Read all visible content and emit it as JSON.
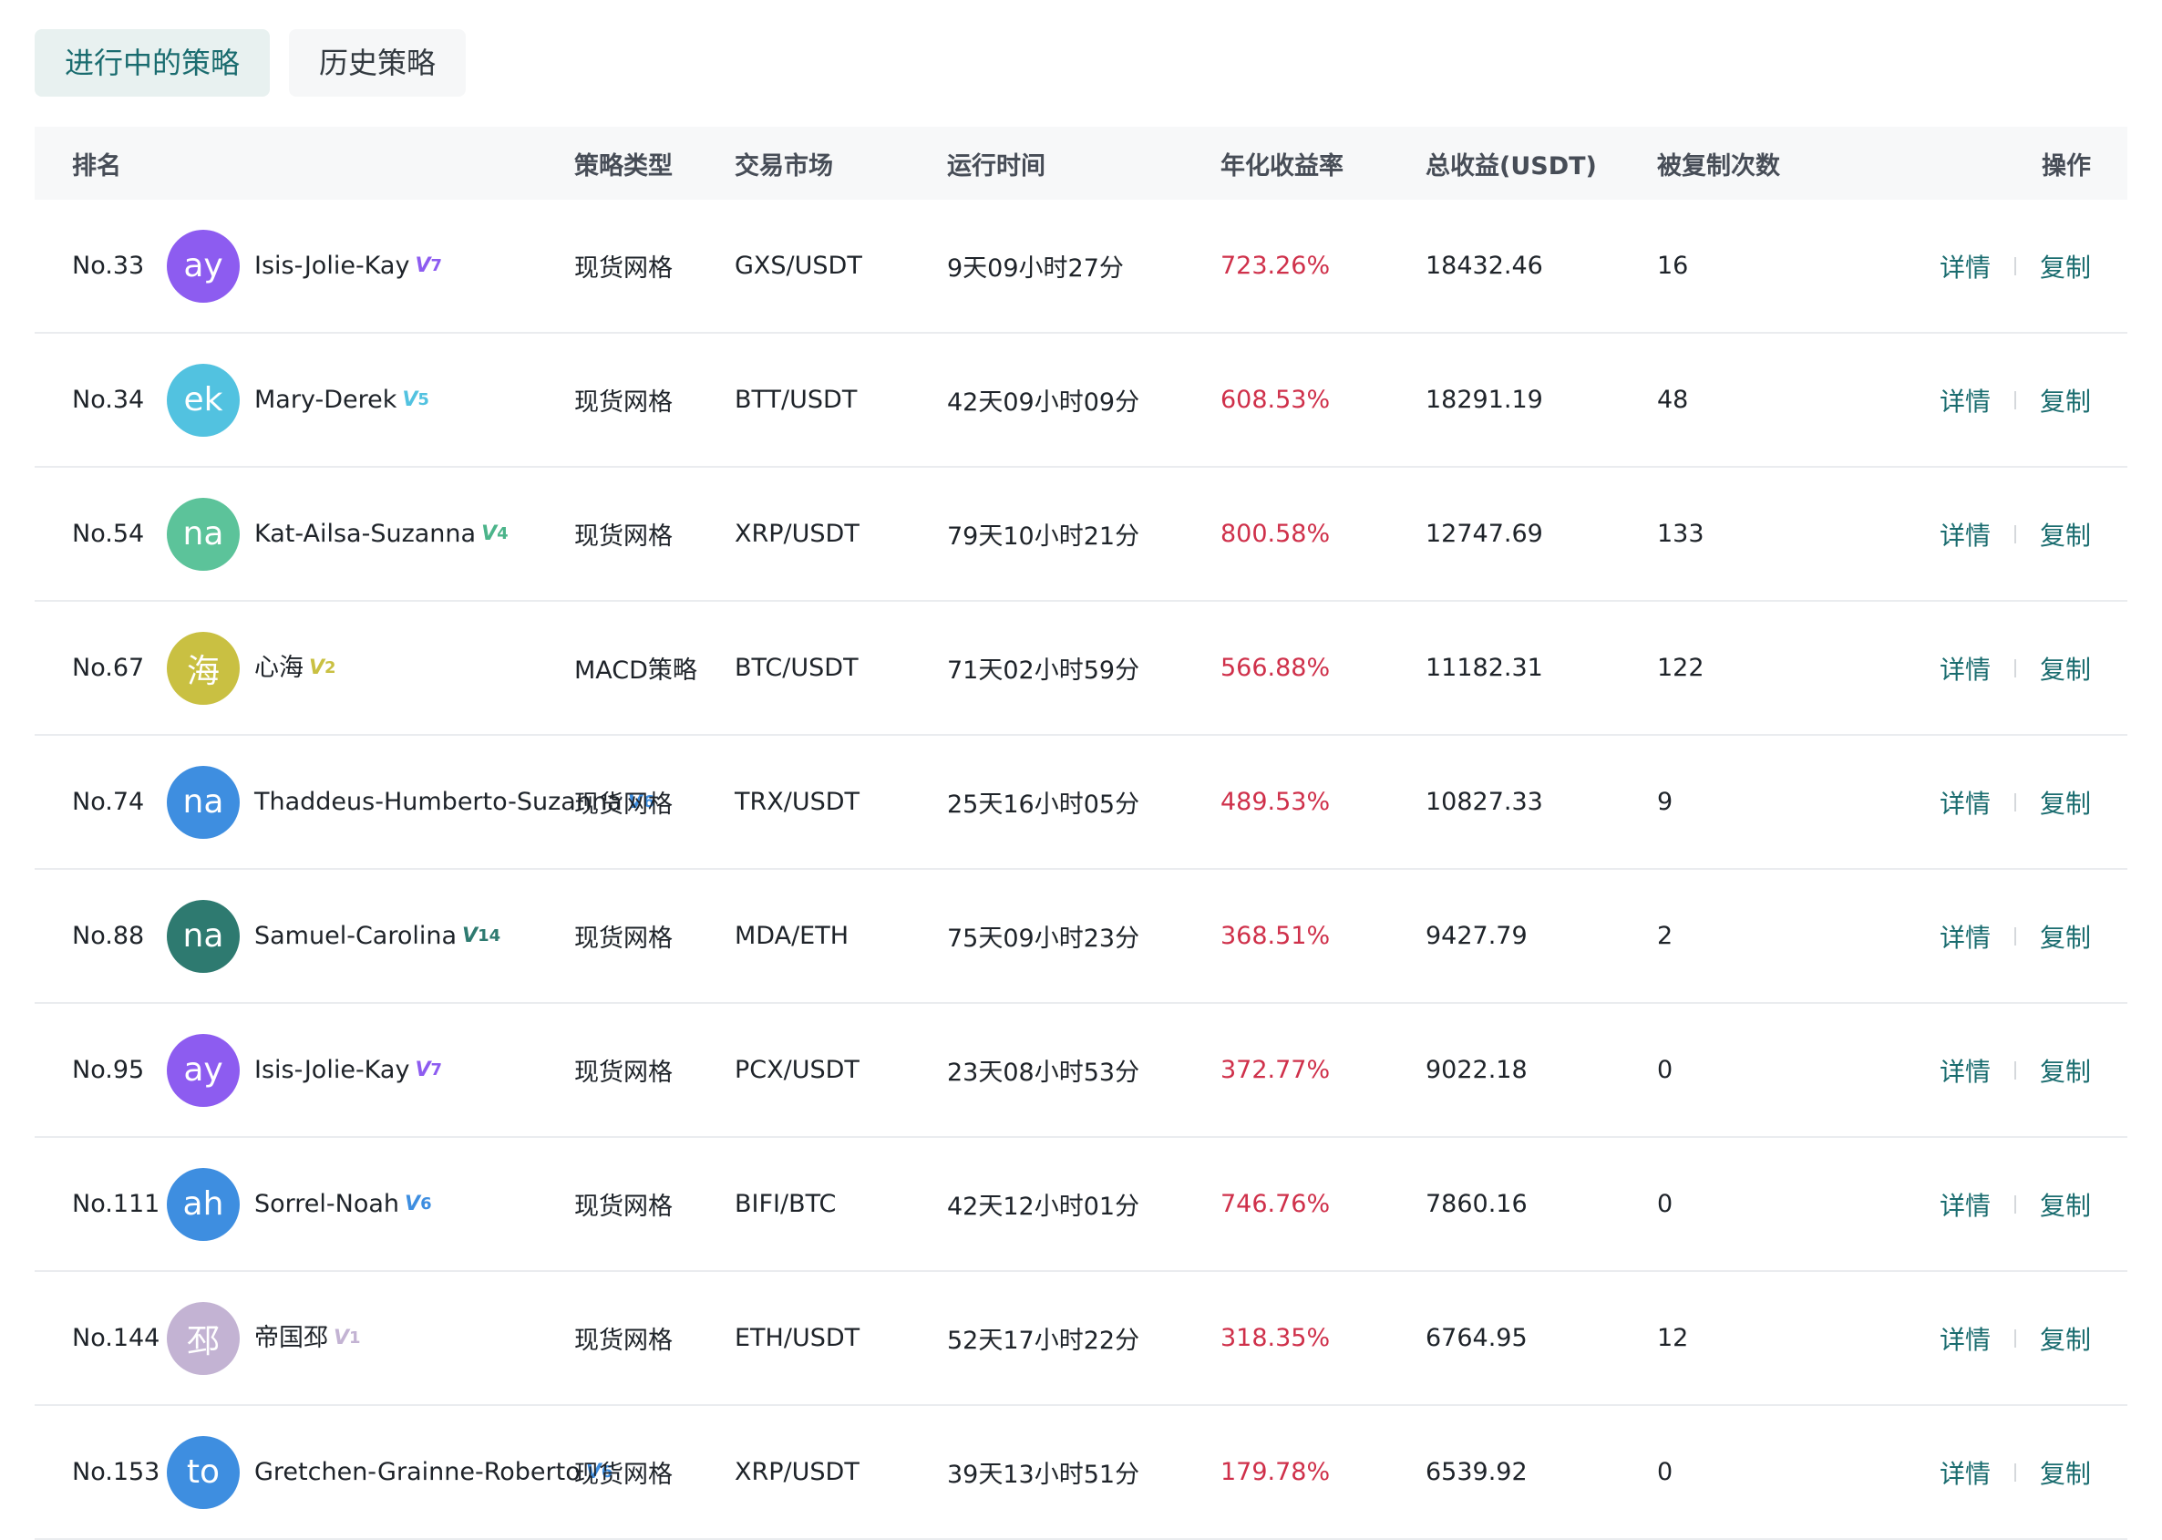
{
  "tabs": [
    {
      "label": "进行中的策略",
      "active": true
    },
    {
      "label": "历史策略",
      "active": false
    }
  ],
  "columns": {
    "rank": "排名",
    "type": "策略类型",
    "market": "交易市场",
    "time": "运行时间",
    "rate": "年化收益率",
    "total": "总收益(USDT)",
    "copies": "被复制次数",
    "op": "操作"
  },
  "actions": {
    "detail": "详情",
    "copy": "复制"
  },
  "colors": {
    "accent": "#1a6c6f",
    "profit": "#cf304a"
  },
  "rows": [
    {
      "rank": "No.33",
      "avatar": "ay",
      "avatar_color": "#8d5cf0",
      "name": "Isis-Jolie-Kay",
      "level": "7",
      "level_color": "#8d5cf0",
      "type": "现货网格",
      "market": "GXS/USDT",
      "time": "9天09小时27分",
      "rate": "723.26%",
      "total": "18432.46",
      "copies": "16"
    },
    {
      "rank": "No.34",
      "avatar": "ek",
      "avatar_color": "#52c2e0",
      "name": "Mary-Derek",
      "level": "5",
      "level_color": "#52c2e0",
      "type": "现货网格",
      "market": "BTT/USDT",
      "time": "42天09小时09分",
      "rate": "608.53%",
      "total": "18291.19",
      "copies": "48"
    },
    {
      "rank": "No.54",
      "avatar": "na",
      "avatar_color": "#5cc39a",
      "name": "Kat-Ailsa-Suzanna",
      "level": "4",
      "level_color": "#4bb48a",
      "type": "现货网格",
      "market": "XRP/USDT",
      "time": "79天10小时21分",
      "rate": "800.58%",
      "total": "12747.69",
      "copies": "133"
    },
    {
      "rank": "No.67",
      "avatar": "海",
      "avatar_color": "#c9c042",
      "name": "心海",
      "level": "2",
      "level_color": "#c9c042",
      "type": "MACD策略",
      "market": "BTC/USDT",
      "time": "71天02小时59分",
      "rate": "566.88%",
      "total": "11182.31",
      "copies": "122"
    },
    {
      "rank": "No.74",
      "avatar": "na",
      "avatar_color": "#3e8ee0",
      "name": "Thaddeus-Humberto-Suzanna",
      "level": "6",
      "level_color": "#3e8ee0",
      "type": "现货网格",
      "market": "TRX/USDT",
      "time": "25天16小时05分",
      "rate": "489.53%",
      "total": "10827.33",
      "copies": "9"
    },
    {
      "rank": "No.88",
      "avatar": "na",
      "avatar_color": "#2e7a70",
      "name": "Samuel-Carolina",
      "level": "14",
      "level_color": "#2e7a70",
      "type": "现货网格",
      "market": "MDA/ETH",
      "time": "75天09小时23分",
      "rate": "368.51%",
      "total": "9427.79",
      "copies": "2"
    },
    {
      "rank": "No.95",
      "avatar": "ay",
      "avatar_color": "#8d5cf0",
      "name": "Isis-Jolie-Kay",
      "level": "7",
      "level_color": "#8d5cf0",
      "type": "现货网格",
      "market": "PCX/USDT",
      "time": "23天08小时53分",
      "rate": "372.77%",
      "total": "9022.18",
      "copies": "0"
    },
    {
      "rank": "No.111",
      "avatar": "ah",
      "avatar_color": "#3e8ee0",
      "name": "Sorrel-Noah",
      "level": "6",
      "level_color": "#3e8ee0",
      "type": "现货网格",
      "market": "BIFI/BTC",
      "time": "42天12小时01分",
      "rate": "746.76%",
      "total": "7860.16",
      "copies": "0"
    },
    {
      "rank": "No.144",
      "avatar": "邳",
      "avatar_color": "#c3b3d3",
      "name": "帝国邳",
      "level": "1",
      "level_color": "#c3b3d3",
      "type": "现货网格",
      "market": "ETH/USDT",
      "time": "52天17小时22分",
      "rate": "318.35%",
      "total": "6764.95",
      "copies": "12"
    },
    {
      "rank": "No.153",
      "avatar": "to",
      "avatar_color": "#3e8ee0",
      "name": "Gretchen-Grainne-Roberto",
      "level": "6",
      "level_color": "#3e8ee0",
      "type": "现货网格",
      "market": "XRP/USDT",
      "time": "39天13小时51分",
      "rate": "179.78%",
      "total": "6539.92",
      "copies": "0"
    }
  ]
}
